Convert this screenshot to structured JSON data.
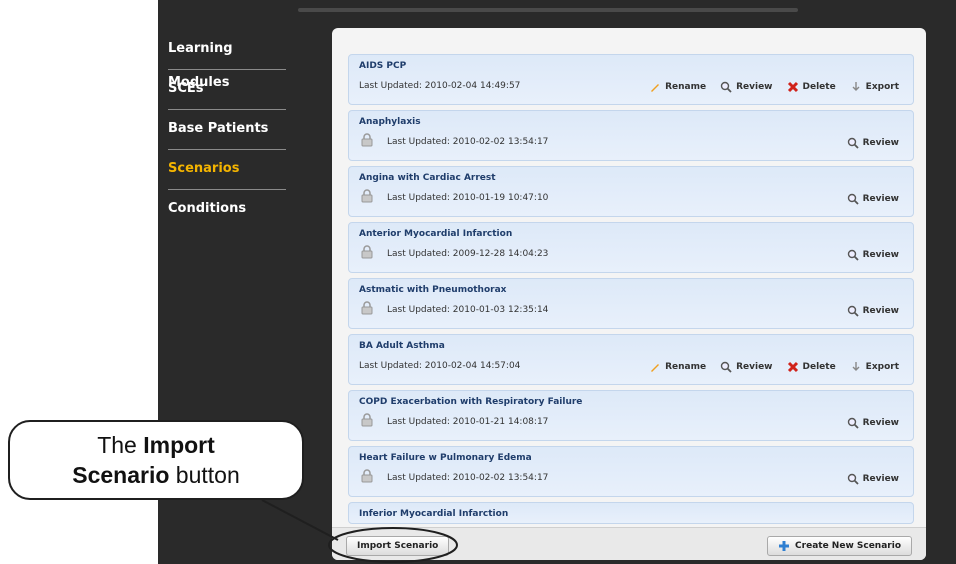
{
  "sidebar": {
    "items": [
      {
        "label": "Learning Modules",
        "active": false
      },
      {
        "label": "SCEs",
        "active": false
      },
      {
        "label": "Base Patients",
        "active": false
      },
      {
        "label": "Scenarios",
        "active": true
      },
      {
        "label": "Conditions",
        "active": false
      }
    ]
  },
  "scenarios": {
    "updated_prefix": "Last Updated: ",
    "actions": {
      "rename": "Rename",
      "review": "Review",
      "delete": "Delete",
      "export": "Export"
    },
    "rows": [
      {
        "title": "AIDS PCP",
        "updated": "Last Updated: 2010-02-04 14:49:57",
        "locked": false
      },
      {
        "title": "Anaphylaxis",
        "updated": "Last Updated: 2010-02-02 13:54:17",
        "locked": true
      },
      {
        "title": "Angina with Cardiac Arrest",
        "updated": "Last Updated: 2010-01-19 10:47:10",
        "locked": true
      },
      {
        "title": "Anterior Myocardial Infarction",
        "updated": "Last Updated: 2009-12-28 14:04:23",
        "locked": true
      },
      {
        "title": "Astmatic with Pneumothorax",
        "updated": "Last Updated: 2010-01-03 12:35:14",
        "locked": true
      },
      {
        "title": "BA Adult Asthma",
        "updated": "Last Updated: 2010-02-04 14:57:04",
        "locked": false
      },
      {
        "title": "COPD Exacerbation with Respiratory Failure",
        "updated": "Last Updated: 2010-01-21 14:08:17",
        "locked": true
      },
      {
        "title": "Heart Failure w Pulmonary Edema",
        "updated": "Last Updated: 2010-02-02 13:54:17",
        "locked": true
      },
      {
        "title": "Inferior Myocardial Infarction",
        "updated": "",
        "locked": true
      }
    ]
  },
  "footer": {
    "import_label": "Import Scenario",
    "create_label": "Create New Scenario"
  },
  "callout": {
    "prefix": "The ",
    "bold1": "Import",
    "bold2": "Scenario",
    "suffix": " button"
  },
  "colors": {
    "active_nav": "#f4b400",
    "row_title": "#1f3d6b",
    "delete": "#d0231b",
    "add": "#2f7fd1"
  }
}
